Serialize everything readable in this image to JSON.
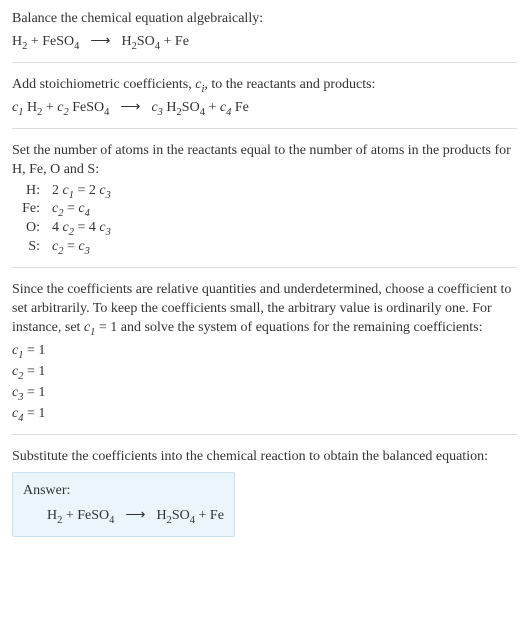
{
  "sections": {
    "balance": {
      "intro": "Balance the chemical equation algebraically:",
      "lhs1": "H",
      "lhs1sub": "2",
      "plus1": " + FeSO",
      "plus1sub": "4",
      "arrow": "⟶",
      "rhs1": "H",
      "rhs1sub": "2",
      "rhs1b": "SO",
      "rhs1bsub": "4",
      "plus2": " + Fe"
    },
    "stoich": {
      "intro_a": "Add stoichiometric coefficients, ",
      "ci": "c",
      "cisub": "i",
      "intro_b": ", to the reactants and products:",
      "c1": "c",
      "c1sub": "1",
      "t1": " H",
      "t1sub": "2",
      "plus1": " + ",
      "c2": "c",
      "c2sub": "2",
      "t2": " FeSO",
      "t2sub": "4",
      "arrow": "⟶",
      "c3": "c",
      "c3sub": "3",
      "t3": " H",
      "t3sub": "2",
      "t3b": "SO",
      "t3bsub": "4",
      "plus2": " + ",
      "c4": "c",
      "c4sub": "4",
      "t4": " Fe"
    },
    "atoms": {
      "intro": "Set the number of atoms in the reactants equal to the number of atoms in the products for H, Fe, O and S:",
      "rows": {
        "h_lbl": "H:",
        "h_eq_a": "2 ",
        "h_c1": "c",
        "h_c1sub": "1",
        "h_eq_b": " = 2 ",
        "h_c3": "c",
        "h_c3sub": "3",
        "fe_lbl": "Fe:",
        "fe_c2": "c",
        "fe_c2sub": "2",
        "fe_eq": " = ",
        "fe_c4": "c",
        "fe_c4sub": "4",
        "o_lbl": "O:",
        "o_eq_a": "4 ",
        "o_c2": "c",
        "o_c2sub": "2",
        "o_eq_b": " = 4 ",
        "o_c3": "c",
        "o_c3sub": "3",
        "s_lbl": "S:",
        "s_c2": "c",
        "s_c2sub": "2",
        "s_eq": " = ",
        "s_c3": "c",
        "s_c3sub": "3"
      }
    },
    "choose": {
      "intro_a": "Since the coefficients are relative quantities and underdetermined, choose a coefficient to set arbitrarily. To keep the coefficients small, the arbitrary value is ordinarily one. For instance, set ",
      "c1": "c",
      "c1sub": "1",
      "intro_b": " = 1 and solve the system of equations for the remaining coefficients:",
      "r1a": "c",
      "r1asub": "1",
      "r1b": " = 1",
      "r2a": "c",
      "r2asub": "2",
      "r2b": " = 1",
      "r3a": "c",
      "r3asub": "3",
      "r3b": " = 1",
      "r4a": "c",
      "r4asub": "4",
      "r4b": " = 1"
    },
    "subst": {
      "intro": "Substitute the coefficients into the chemical reaction to obtain the balanced equation:"
    },
    "answer": {
      "label": "Answer:",
      "lhs1": "H",
      "lhs1sub": "2",
      "plus1": " + FeSO",
      "plus1sub": "4",
      "arrow": "⟶",
      "rhs1": "H",
      "rhs1sub": "2",
      "rhs1b": "SO",
      "rhs1bsub": "4",
      "plus2": " + Fe"
    }
  }
}
